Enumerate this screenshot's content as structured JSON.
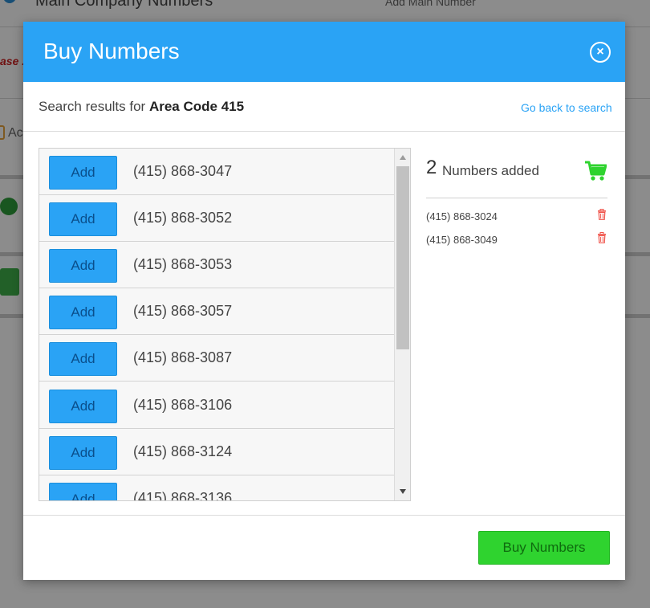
{
  "background": {
    "header_title": "Main Company Numbers",
    "header_right": "Add Main Number",
    "warning_fragment": "ase .",
    "row_text": "Ac"
  },
  "modal": {
    "title": "Buy Numbers",
    "close_label": "×",
    "search_prefix": "Search results for ",
    "search_query": "Area Code 415",
    "back_link": "Go back to search",
    "add_label": "Add",
    "results": [
      {
        "number": "(415) 868-3047"
      },
      {
        "number": "(415) 868-3052"
      },
      {
        "number": "(415) 868-3053"
      },
      {
        "number": "(415) 868-3057"
      },
      {
        "number": "(415) 868-3087"
      },
      {
        "number": "(415) 868-3106"
      },
      {
        "number": "(415) 868-3124"
      },
      {
        "number": "(415) 868-3136"
      }
    ],
    "cart": {
      "count": "2",
      "label": "Numbers added",
      "items": [
        "(415) 868-3024",
        "(415) 868-3049"
      ]
    },
    "buy_button": "Buy Numbers"
  },
  "colors": {
    "header_blue": "#2aa3f5",
    "buy_green": "#2fd32f",
    "cart_icon_green": "#2fd32f",
    "trash_red": "#f0534a"
  },
  "icons": {
    "close": "close-icon",
    "cart": "shopping-cart-icon",
    "trash": "trash-icon",
    "scroll_up": "chevron-up-icon",
    "scroll_down": "chevron-down-icon"
  }
}
